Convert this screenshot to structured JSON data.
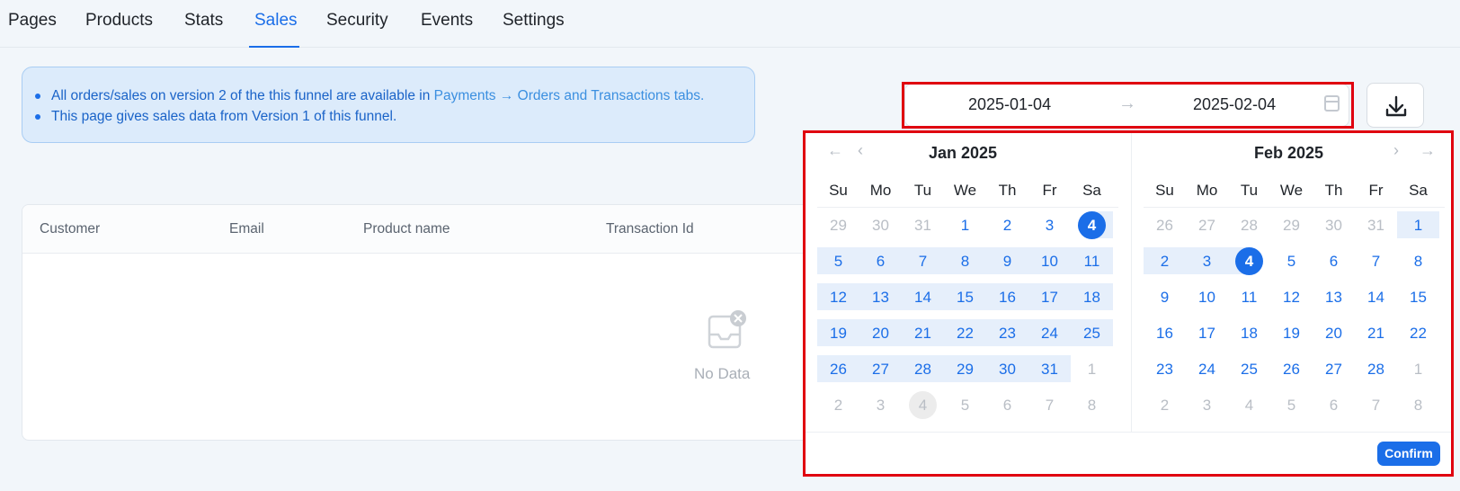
{
  "tabs": [
    "Pages",
    "Products",
    "Stats",
    "Sales",
    "Security",
    "Events",
    "Settings"
  ],
  "active_tab": "Sales",
  "banner": {
    "line1_text": "All orders/sales on version 2 of the this funnel are available in ",
    "line1_link": "Payments → Orders and Transactions tabs.",
    "line2_text": "This page gives sales data from Version 1 of this funnel."
  },
  "range": {
    "start": "2025-01-04",
    "end": "2025-02-04",
    "arrow": "→",
    "calendar_icon": "calendar-icon"
  },
  "download_icon": "download-icon",
  "table": {
    "columns": [
      "Customer",
      "Email",
      "Product name",
      "Transaction Id"
    ],
    "empty_text": "No Data",
    "empty_icon": "empty-inbox-icon"
  },
  "calendar": {
    "weekdays": [
      "Su",
      "Mo",
      "Tu",
      "We",
      "Th",
      "Fr",
      "Sa"
    ],
    "nav": {
      "prev_year": "←",
      "prev_month": "‹",
      "next_month": "›",
      "next_year": "→"
    },
    "left_month": "Jan 2025",
    "right_month": "Feb 2025",
    "confirm_label": "Confirm",
    "left_days": [
      [
        "29",
        "30",
        "31",
        "1",
        "2",
        "3",
        "4"
      ],
      [
        "5",
        "6",
        "7",
        "8",
        "9",
        "10",
        "11"
      ],
      [
        "12",
        "13",
        "14",
        "15",
        "16",
        "17",
        "18"
      ],
      [
        "19",
        "20",
        "21",
        "22",
        "23",
        "24",
        "25"
      ],
      [
        "26",
        "27",
        "28",
        "29",
        "30",
        "31",
        "1"
      ],
      [
        "2",
        "3",
        "4",
        "5",
        "6",
        "7",
        "8"
      ]
    ],
    "right_days": [
      [
        "26",
        "27",
        "28",
        "29",
        "30",
        "31",
        "1"
      ],
      [
        "2",
        "3",
        "4",
        "5",
        "6",
        "7",
        "8"
      ],
      [
        "9",
        "10",
        "11",
        "12",
        "13",
        "14",
        "15"
      ],
      [
        "16",
        "17",
        "18",
        "19",
        "20",
        "21",
        "22"
      ],
      [
        "23",
        "24",
        "25",
        "26",
        "27",
        "28",
        "1"
      ],
      [
        "2",
        "3",
        "4",
        "5",
        "6",
        "7",
        "8"
      ]
    ]
  },
  "colors": {
    "accent": "#1b6ee8",
    "range_bg": "#e6effb",
    "highlight_border": "#e0000f"
  }
}
